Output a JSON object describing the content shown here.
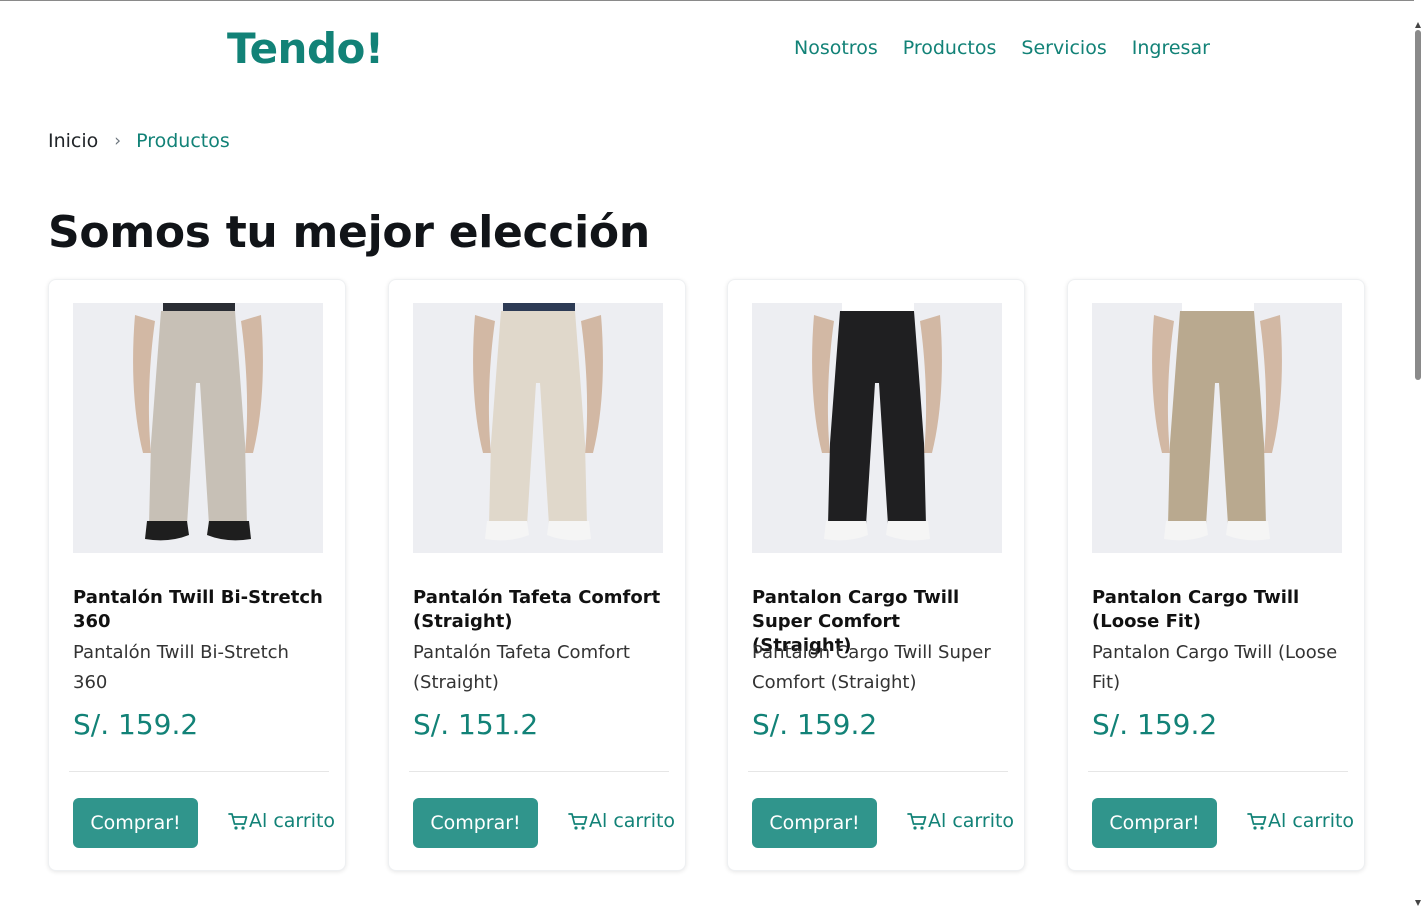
{
  "brand": {
    "name": "Tendo!",
    "color": "#128277"
  },
  "nav": {
    "items": [
      "Nosotros",
      "Productos",
      "Servicios",
      "Ingresar"
    ]
  },
  "breadcrumb": {
    "home": "Inicio",
    "separator": "›",
    "current": "Productos"
  },
  "heading": "Somos tu mejor elección",
  "products": [
    {
      "title": "Pantalón Twill Bi-Stretch 360",
      "description": "Pantalón Twill Bi-Stretch 360",
      "price": "S/. 159.2",
      "pants_color": "#c7c0b6",
      "shirt_color": "#2a2d34",
      "shoe_color": "#1e1e1e",
      "buy_label": "Comprar!",
      "cart_label": "Al carrito",
      "cart_icon": "cart-icon"
    },
    {
      "title": "Pantalón Tafeta Comfort (Straight)",
      "description": "Pantalón Tafeta Comfort (Straight)",
      "price": "S/. 151.2",
      "pants_color": "#e0d8cb",
      "shirt_color": "#2d3b55",
      "shoe_color": "#f5f5f5",
      "buy_label": "Comprar!",
      "cart_label": "Al carrito",
      "cart_icon": "cart-icon"
    },
    {
      "title": "Pantalon Cargo Twill Super Comfort (Straight)",
      "description": "Pantalon Cargo Twill Super Comfort (Straight)",
      "price": "S/. 159.2",
      "pants_color": "#1f1f21",
      "shirt_color": "#ffffff",
      "shoe_color": "#f5f5f5",
      "buy_label": "Comprar!",
      "cart_label": "Al carrito",
      "cart_icon": "cart-icon"
    },
    {
      "title": "Pantalon Cargo Twill (Loose Fit)",
      "description": "Pantalon Cargo Twill (Loose Fit)",
      "price": "S/. 159.2",
      "pants_color": "#b9a98f",
      "shirt_color": "#ffffff",
      "shoe_color": "#f5f5f5",
      "buy_label": "Comprar!",
      "cart_label": "Al carrito",
      "cart_icon": "cart-icon"
    }
  ]
}
